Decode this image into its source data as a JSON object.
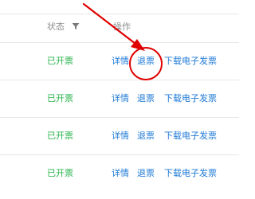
{
  "table": {
    "headers": {
      "status": "状态",
      "actions": "操作"
    },
    "rows": [
      {
        "status": "已开票",
        "detail": "详情",
        "refund": "退票",
        "download": "下载电子发票"
      },
      {
        "status": "已开票",
        "detail": "详情",
        "refund": "退票",
        "download": "下载电子发票"
      },
      {
        "status": "已开票",
        "detail": "详情",
        "refund": "退票",
        "download": "下载电子发票"
      },
      {
        "status": "已开票",
        "detail": "详情",
        "refund": "退票",
        "download": "下载电子发票"
      }
    ]
  },
  "icons": {
    "filter": "filter-icon"
  },
  "colors": {
    "status_green": "#27b34a",
    "link_blue": "#1e79d6",
    "header_gray": "#8c8c8c",
    "annotation_red": "#e00000"
  }
}
